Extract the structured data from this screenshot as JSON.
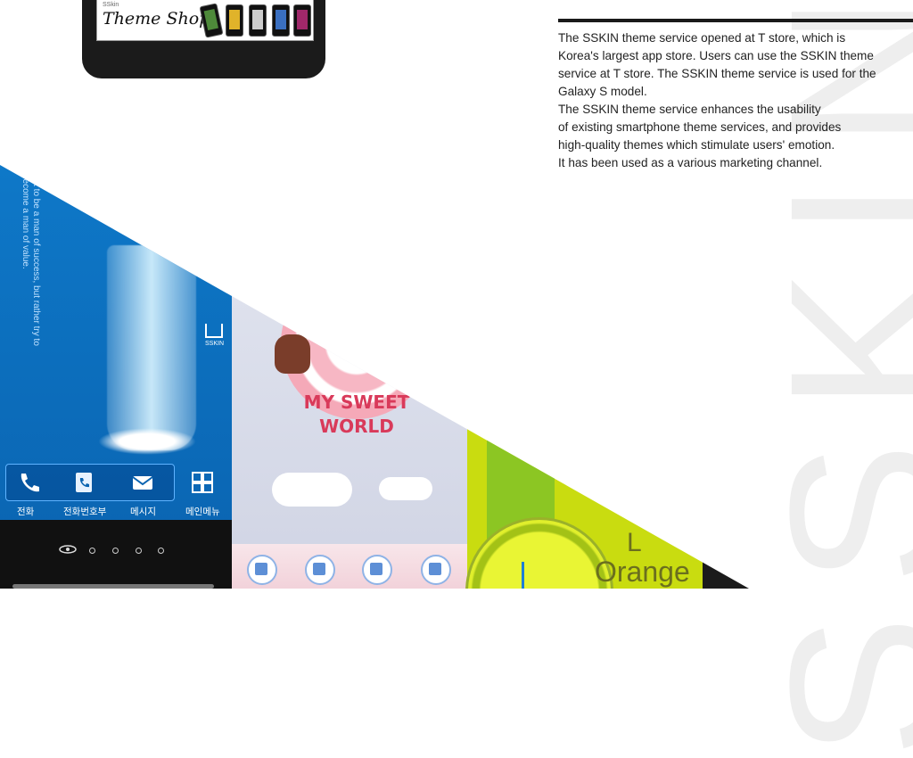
{
  "watermark": "SSKIN",
  "banner": {
    "small": "SSkin",
    "title": "Theme Shop"
  },
  "description": {
    "lines": [
      "The SSKIN theme service opened at T store, which is",
      "Korea's largest app store. Users can use the SSKIN theme",
      "service at T store. The SSKIN theme service is used for the",
      "Galaxy S model.",
      "The SSKIN theme service enhances the usability",
      "of existing smartphone theme services, and provides",
      "high-quality themes which stimulate users' emotion.",
      "It has been used as a various marketing channel."
    ]
  },
  "blue_theme": {
    "quote": "not to be a man of success, but rather try to become a man of value.",
    "logo_text": "SSKIN",
    "labels": [
      "전화",
      "전화번호부",
      "메시지",
      "메인메뉴"
    ]
  },
  "pink_theme": {
    "title_line1": "MY SWEET",
    "title_line2": "WORLD"
  },
  "lime_theme": {
    "word_top": "L",
    "word": "Orange"
  },
  "colors": {
    "blue": "#0e78c8",
    "pink_text": "#d93a5a",
    "lime": "#c9dc10"
  }
}
